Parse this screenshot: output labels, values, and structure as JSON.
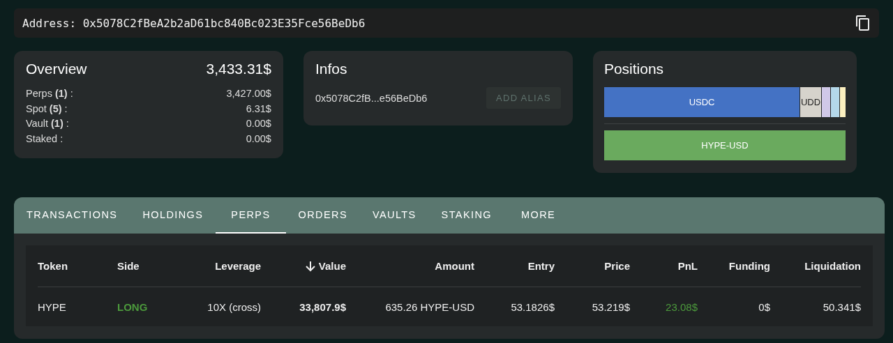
{
  "address_bar": {
    "label": "Address:",
    "value": "0x5078C2fBeA2b2aD61bc840Bc023E35Fce56BeDb6"
  },
  "overview": {
    "title": "Overview",
    "total": "3,433.31$",
    "rows": [
      {
        "label": "Perps **(1)** :",
        "value": "3,427.00$"
      },
      {
        "label": "Spot **(5)** :",
        "value": "6.31$"
      },
      {
        "label": "Vault **(1)** :",
        "value": "0.00$"
      },
      {
        "label": "Staked :",
        "value": "0.00$"
      }
    ]
  },
  "infos": {
    "title": "Infos",
    "short_address": "0x5078C2fB...e56BeDb6",
    "button": "ADD ALIAS",
    "button_disabled": true
  },
  "positions": {
    "title": "Positions",
    "bars": [
      {
        "segments": [
          {
            "label": "USDC",
            "color": "#4472c4"
          },
          {
            "label": "UDD",
            "color": "#d6d3cc"
          },
          {
            "color": "#d0c8e8"
          },
          {
            "color": "#b4d8ea"
          },
          {
            "color": "#fbf0c0"
          }
        ]
      },
      {
        "segments": [
          {
            "label": "HYPE-USD",
            "color": "#6aaa5e"
          }
        ]
      }
    ]
  },
  "tabs": [
    {
      "label": "TRANSACTIONS",
      "selected": false
    },
    {
      "label": "HOLDINGS",
      "selected": false
    },
    {
      "label": "PERPS",
      "selected": true
    },
    {
      "label": "ORDERS",
      "selected": false
    },
    {
      "label": "VAULTS",
      "selected": false
    },
    {
      "label": "STAKING",
      "selected": false
    },
    {
      "label": "MORE",
      "selected": false
    }
  ],
  "table": {
    "columns": [
      {
        "label": "Token",
        "sorted": false
      },
      {
        "label": "Side",
        "sorted": false
      },
      {
        "label": "Leverage",
        "sorted": false
      },
      {
        "label": "Value",
        "sorted": true
      },
      {
        "label": "Amount",
        "sorted": false
      },
      {
        "label": "Entry",
        "sorted": false
      },
      {
        "label": "Price",
        "sorted": false
      },
      {
        "label": "PnL",
        "sorted": false
      },
      {
        "label": "Funding",
        "sorted": false
      },
      {
        "label": "Liquidation",
        "sorted": false
      }
    ],
    "rows": [
      {
        "cells": [
          {
            "text": "HYPE",
            "kind": "plain"
          },
          {
            "text": "LONG",
            "kind": "positive-bold"
          },
          {
            "text": "10X (cross)",
            "kind": "plain"
          },
          {
            "text": "33,807.9$",
            "kind": "bold"
          },
          {
            "text": "635.26 HYPE-USD",
            "kind": "plain"
          },
          {
            "text": "53.1826$",
            "kind": "plain"
          },
          {
            "text": "53.219$",
            "kind": "plain"
          },
          {
            "text": "23.08$",
            "kind": "positive"
          },
          {
            "text": "0$",
            "kind": "plain"
          },
          {
            "text": "50.341$",
            "kind": "plain"
          }
        ]
      }
    ]
  }
}
